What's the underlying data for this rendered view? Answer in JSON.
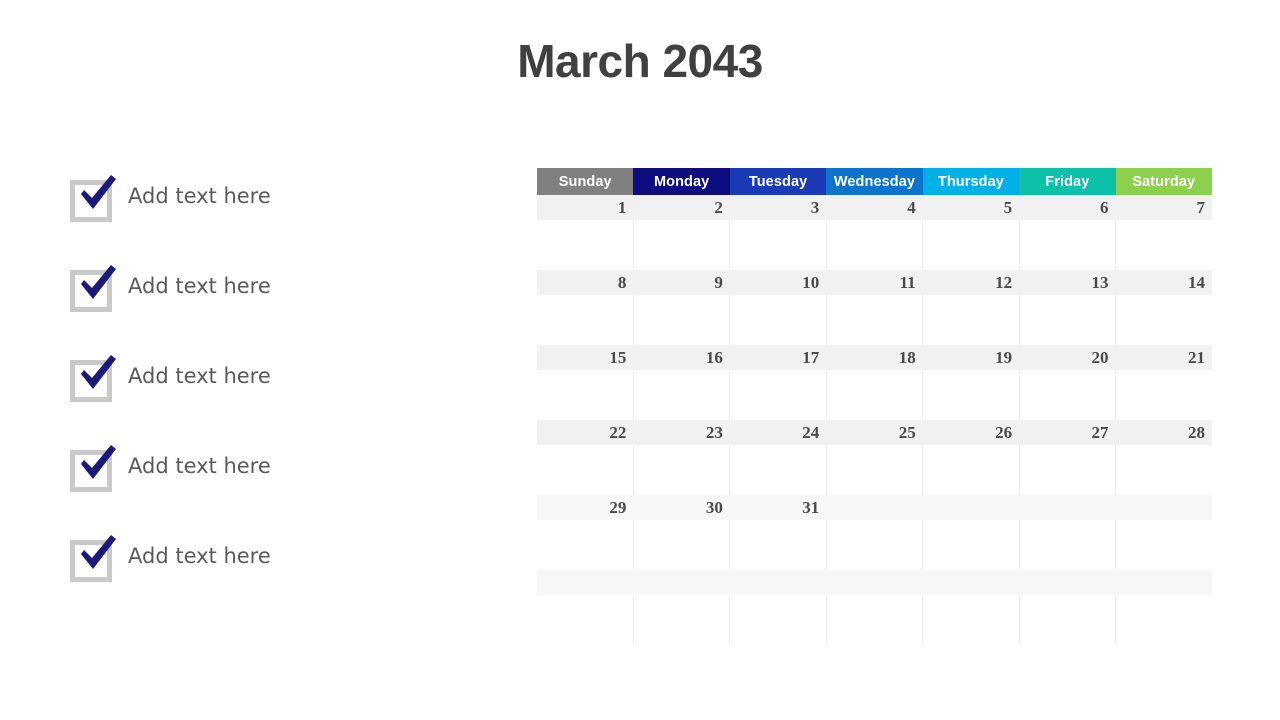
{
  "page": {
    "title": "March 2043",
    "background_color": "#ffffff",
    "title_color": "#404040"
  },
  "checklist": {
    "items": [
      {
        "label": "Add text here",
        "checked": true
      },
      {
        "label": "Add text here",
        "checked": true
      },
      {
        "label": "Add text here",
        "checked": true
      },
      {
        "label": "Add text here",
        "checked": true
      },
      {
        "label": "Add text here",
        "checked": true
      }
    ],
    "checkmark_color": "#1a1a7a",
    "box_border_color": "#c9c9c9",
    "label_color": "#5a5a5a"
  },
  "calendar": {
    "month": "March",
    "year": "2043",
    "day_headers": [
      {
        "label": "Sunday",
        "color": "#808080"
      },
      {
        "label": "Monday",
        "color": "#0d0d80"
      },
      {
        "label": "Tuesday",
        "color": "#1a3bb5"
      },
      {
        "label": "Wednesday",
        "color": "#0d74ce"
      },
      {
        "label": "Thursday",
        "color": "#00b0e6"
      },
      {
        "label": "Friday",
        "color": "#0dc1a8"
      },
      {
        "label": "Saturday",
        "color": "#8cd04e"
      }
    ],
    "weeks": [
      {
        "days": [
          "1",
          "2",
          "3",
          "4",
          "5",
          "6",
          "7"
        ]
      },
      {
        "days": [
          "8",
          "9",
          "10",
          "11",
          "12",
          "13",
          "14"
        ]
      },
      {
        "days": [
          "15",
          "16",
          "17",
          "18",
          "19",
          "20",
          "21"
        ]
      },
      {
        "days": [
          "22",
          "23",
          "24",
          "25",
          "26",
          "27",
          "28"
        ]
      },
      {
        "days": [
          "29",
          "30",
          "31",
          "",
          "",
          "",
          ""
        ]
      },
      {
        "days": [
          "",
          "",
          "",
          "",
          "",
          "",
          ""
        ]
      }
    ],
    "band_color": "#f1f1f1",
    "band_color_alt": "#f7f7f7",
    "cell_border_color": "#ededed",
    "number_color": "#4a4a4a"
  }
}
